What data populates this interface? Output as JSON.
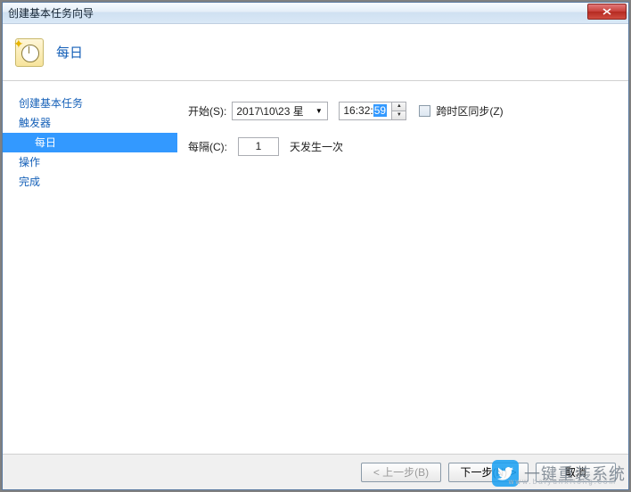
{
  "window": {
    "title": "创建基本任务向导"
  },
  "header": {
    "title": "每日"
  },
  "sidebar": {
    "items": [
      {
        "label": "创建基本任务",
        "indent": false,
        "selected": false
      },
      {
        "label": "触发器",
        "indent": false,
        "selected": false
      },
      {
        "label": "每日",
        "indent": true,
        "selected": true
      },
      {
        "label": "操作",
        "indent": false,
        "selected": false
      },
      {
        "label": "完成",
        "indent": false,
        "selected": false
      }
    ]
  },
  "form": {
    "start_label": "开始(S):",
    "date_value": "2017\\10\\23 星",
    "time_prefix": "16:32:",
    "time_selected": "59",
    "sync_label": "跨时区同步(Z)",
    "recur_label": "每隔(C):",
    "recur_value": "1",
    "recur_suffix": "天发生一次"
  },
  "footer": {
    "back": "< 上一步(B)",
    "next": "下一步(N) >",
    "cancel": "取消"
  },
  "watermark": {
    "brand": "一键重装系统",
    "url": "www.baiyunxitong.com"
  }
}
